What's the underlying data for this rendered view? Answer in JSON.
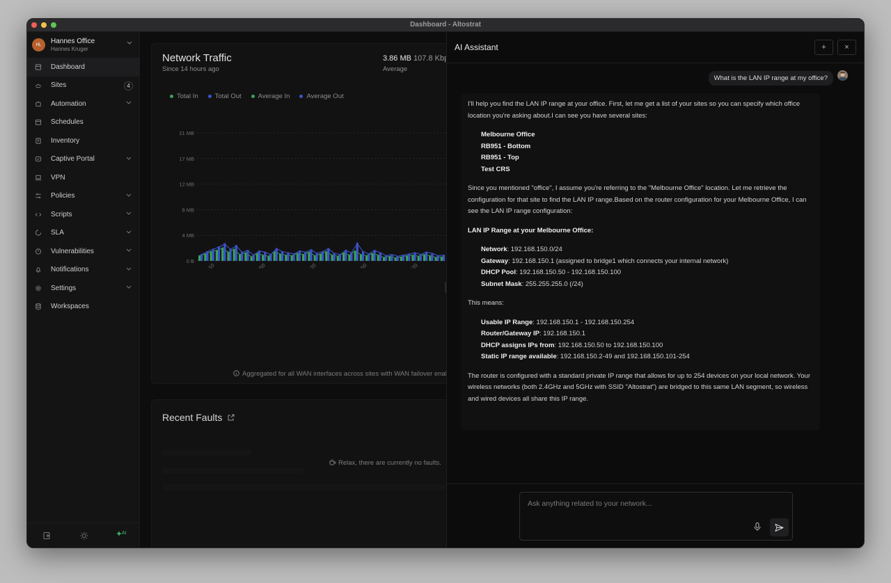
{
  "window": {
    "title": "Dashboard - Altostrat"
  },
  "account": {
    "initials": "HL",
    "name": "Hannes Office",
    "user": "Hannes Kruger"
  },
  "sidebar": {
    "items": [
      {
        "label": "Dashboard",
        "icon": "dashboard-icon",
        "active": true
      },
      {
        "label": "Sites",
        "icon": "sites-icon",
        "badge": "4"
      },
      {
        "label": "Automation",
        "icon": "automation-icon",
        "expandable": true
      },
      {
        "label": "Schedules",
        "icon": "calendar-icon"
      },
      {
        "label": "Inventory",
        "icon": "inventory-icon"
      },
      {
        "label": "Captive Portal",
        "icon": "portal-icon",
        "expandable": true
      },
      {
        "label": "VPN",
        "icon": "vpn-icon"
      },
      {
        "label": "Policies",
        "icon": "policies-icon",
        "expandable": true
      },
      {
        "label": "Scripts",
        "icon": "code-icon",
        "expandable": true
      },
      {
        "label": "SLA",
        "icon": "sla-icon",
        "expandable": true
      },
      {
        "label": "Vulnerabilities",
        "icon": "shield-icon",
        "expandable": true
      },
      {
        "label": "Notifications",
        "icon": "bell-icon",
        "expandable": true
      },
      {
        "label": "Settings",
        "icon": "gear-icon",
        "expandable": true
      },
      {
        "label": "Workspaces",
        "icon": "database-icon"
      }
    ],
    "bottom_ai_label": "AI"
  },
  "network_traffic": {
    "title": "Network Traffic",
    "subtitle": "Since 14 hours ago",
    "total": "3.86 MB",
    "rate": "107.8 Kbp",
    "rate_label": "Average",
    "note": "Aggregated for all WAN interfaces across sites with WAN failover enab"
  },
  "chart_data": {
    "type": "bar",
    "legend": [
      "Total In",
      "Total Out",
      "Average In",
      "Average Out"
    ],
    "colors": {
      "in": "#3aa35c",
      "out": "#3b55c9",
      "avg_in": "#2f8f4f",
      "avg_out": "#3a4fb8"
    },
    "y_ticks": [
      "21 MB",
      "17 MB",
      "12 MB",
      "8 MB",
      "4 MB",
      "0 B"
    ],
    "ylim": [
      0,
      21
    ],
    "x_ticks": [
      "02:10",
      "02:50",
      "03:20",
      "03:50",
      "04:20"
    ],
    "series": [
      {
        "name": "Total In",
        "values": [
          0.9,
          1.2,
          1.6,
          1.8,
          2.2,
          1.5,
          2.0,
          1.1,
          1.4,
          0.7,
          1.3,
          1.0,
          0.8,
          1.6,
          1.2,
          1.0,
          0.9,
          1.3,
          1.1,
          1.5,
          0.9,
          1.2,
          1.6,
          1.0,
          0.8,
          1.4,
          1.0,
          1.7,
          1.1,
          0.9,
          1.3,
          1.0,
          0.6,
          0.8,
          0.5,
          0.7,
          0.9,
          1.0,
          0.8,
          1.1,
          0.9,
          0.6,
          0.7
        ]
      },
      {
        "name": "Total Out",
        "values": [
          1.1,
          1.6,
          2.0,
          2.4,
          2.9,
          2.0,
          2.6,
          1.5,
          1.8,
          1.0,
          1.7,
          1.5,
          1.1,
          2.1,
          1.6,
          1.4,
          1.2,
          1.7,
          1.5,
          1.9,
          1.3,
          1.6,
          2.1,
          1.3,
          1.1,
          1.8,
          1.4,
          3.0,
          1.6,
          1.2,
          1.8,
          1.4,
          0.9,
          1.1,
          0.8,
          1.0,
          1.2,
          1.4,
          1.1,
          1.5,
          1.3,
          0.9,
          1.0
        ]
      }
    ]
  },
  "recent_faults": {
    "title": "Recent Faults",
    "empty": "Relax, there are currently no faults."
  },
  "assistant": {
    "title": "AI Assistant",
    "new_label": "+",
    "close_label": "×",
    "user_message": "What is the LAN IP range at my office?",
    "response": {
      "intro": "I'll help you find the LAN IP range at your office. First, let me get a list of your sites so you can specify which office location you're asking about.I can see you have several sites:",
      "sites": [
        "Melbourne Office",
        "RB951 - Bottom",
        "RB951 - Top",
        "Test CRS"
      ],
      "para2": "Since you mentioned \"office\", I assume you're referring to the \"Melbourne Office\" location. Let me retrieve the configuration for that site to find the LAN IP range.Based on the router configuration for your Melbourne Office, I can see the LAN IP range configuration:",
      "heading": "LAN IP Range at your Melbourne Office:",
      "details": [
        {
          "k": "Network",
          "v": ": 192.168.150.0/24"
        },
        {
          "k": "Gateway",
          "v": ": 192.168.150.1 (assigned to bridge1 which connects your internal network)"
        },
        {
          "k": "DHCP Pool",
          "v": ": 192.168.150.50 - 192.168.150.100"
        },
        {
          "k": "Subnet Mask",
          "v": ": 255.255.255.0 (/24)"
        }
      ],
      "means": "This means:",
      "meaning": [
        {
          "k": "Usable IP Range",
          "v": ": 192.168.150.1 - 192.168.150.254"
        },
        {
          "k": "Router/Gateway IP",
          "v": ": 192.168.150.1"
        },
        {
          "k": "DHCP assigns IPs from",
          "v": ": 192.168.150.50 to 192.168.150.100"
        },
        {
          "k": "Static IP range available",
          "v": ": 192.168.150.2-49 and 192.168.150.101-254"
        }
      ],
      "closing": "The router is configured with a standard private IP range that allows for up to 254 devices on your local network. Your wireless networks (both 2.4GHz and 5GHz with SSID \"Altostrat\") are bridged to this same LAN segment, so wireless and wired devices all share this IP range."
    },
    "input_placeholder": "Ask anything related to your network..."
  }
}
